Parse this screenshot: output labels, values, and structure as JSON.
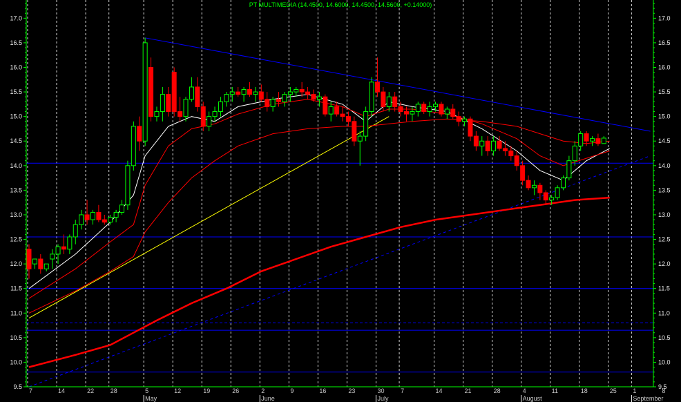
{
  "chart_data": {
    "type": "candlestick",
    "title": "PT MULTIMEDIA (14.4500, 14.6000, 14.4500, 14.5600, +0.14000)",
    "ylim": [
      9.5,
      17.3
    ],
    "y_ticks": [
      "9.5",
      "10.0",
      "10.5",
      "11.0",
      "11.5",
      "12.0",
      "12.5",
      "13.0",
      "13.5",
      "14.0",
      "14.5",
      "15.0",
      "15.5",
      "16.0",
      "16.5",
      "17.0"
    ],
    "x_date_labels": [
      "7",
      "14",
      "22",
      "28",
      "5",
      "12",
      "19",
      "26",
      "2",
      "9",
      "16",
      "23",
      "30",
      "7",
      "14",
      "21",
      "28",
      "4",
      "11",
      "18",
      "25",
      "1",
      "8"
    ],
    "x_month_labels": [
      {
        "label": "May",
        "at": "5"
      },
      {
        "label": "June",
        "at": "2"
      },
      {
        "label": "July",
        "at": "30"
      },
      {
        "label": "August",
        "at": "4"
      },
      {
        "label": "September",
        "at": "1"
      }
    ],
    "colors": {
      "background": "#000000",
      "up": "#00ff00",
      "down": "#ff0000",
      "grid": "#ffffff",
      "axis": "#00ff00",
      "horizontal_levels": "#0000ff",
      "ema_fast": "#ffffff",
      "ema_mid": "#ff0000",
      "ema_long": "#ff0000",
      "trend_support": "#ffff00",
      "trend_resistance": "#0000ff"
    },
    "horizontal_levels": [
      14.05,
      12.55,
      11.5,
      10.8,
      10.65,
      9.8
    ],
    "series": [
      {
        "type": "ohlc",
        "values": [
          [
            12.3,
            12.4,
            11.7,
            11.9
          ],
          [
            12.0,
            12.1,
            11.9,
            12.1
          ],
          [
            12.1,
            12.2,
            11.8,
            11.9
          ],
          [
            11.9,
            12.0,
            11.85,
            12.0
          ],
          [
            12.1,
            12.3,
            11.9,
            12.2
          ],
          [
            12.2,
            12.4,
            12.0,
            12.35
          ],
          [
            12.35,
            12.6,
            12.2,
            12.3
          ],
          [
            12.3,
            12.6,
            12.2,
            12.55
          ],
          [
            12.55,
            12.9,
            12.4,
            12.8
          ],
          [
            12.8,
            13.1,
            12.7,
            13.0
          ],
          [
            13.0,
            13.3,
            12.8,
            12.9
          ],
          [
            12.9,
            13.1,
            12.8,
            13.05
          ],
          [
            13.05,
            13.2,
            12.85,
            12.9
          ],
          [
            12.9,
            13.0,
            12.8,
            12.85
          ],
          [
            12.85,
            13.0,
            12.8,
            12.95
          ],
          [
            12.95,
            13.1,
            12.85,
            13.05
          ],
          [
            13.05,
            13.3,
            13.0,
            13.2
          ],
          [
            13.2,
            14.1,
            13.1,
            14.0
          ],
          [
            14.0,
            14.9,
            13.9,
            14.8
          ],
          [
            14.8,
            15.0,
            14.3,
            14.5
          ],
          [
            14.5,
            16.6,
            14.4,
            16.5
          ],
          [
            16.0,
            16.2,
            14.9,
            15.0
          ],
          [
            15.0,
            15.2,
            14.9,
            15.1
          ],
          [
            15.1,
            15.6,
            14.9,
            15.45
          ],
          [
            15.45,
            15.6,
            15.0,
            15.1
          ],
          [
            15.9,
            16.0,
            15.0,
            15.1
          ],
          [
            15.1,
            15.4,
            14.9,
            15.0
          ],
          [
            15.0,
            15.4,
            14.9,
            15.35
          ],
          [
            15.35,
            15.8,
            15.3,
            15.6
          ],
          [
            15.6,
            15.8,
            15.1,
            15.2
          ],
          [
            15.2,
            15.3,
            14.7,
            14.8
          ],
          [
            14.8,
            15.1,
            14.7,
            15.0
          ],
          [
            15.0,
            15.2,
            14.9,
            15.1
          ],
          [
            15.1,
            15.4,
            15.0,
            15.3
          ],
          [
            15.3,
            15.5,
            15.2,
            15.45
          ],
          [
            15.45,
            15.6,
            15.3,
            15.5
          ],
          [
            15.5,
            15.6,
            15.4,
            15.45
          ],
          [
            15.45,
            15.6,
            15.3,
            15.55
          ],
          [
            15.55,
            15.7,
            15.4,
            15.45
          ],
          [
            15.45,
            15.6,
            15.3,
            15.5
          ],
          [
            15.5,
            15.65,
            15.3,
            15.35
          ],
          [
            15.35,
            15.5,
            15.1,
            15.2
          ],
          [
            15.2,
            15.4,
            15.1,
            15.35
          ],
          [
            15.35,
            15.5,
            15.2,
            15.3
          ],
          [
            15.3,
            15.5,
            15.2,
            15.45
          ],
          [
            15.45,
            15.6,
            15.3,
            15.5
          ],
          [
            15.5,
            15.6,
            15.4,
            15.55
          ],
          [
            15.55,
            15.7,
            15.4,
            15.5
          ],
          [
            15.5,
            15.6,
            15.35,
            15.45
          ],
          [
            15.45,
            15.55,
            15.3,
            15.35
          ],
          [
            15.35,
            15.5,
            15.2,
            15.4
          ],
          [
            15.4,
            15.45,
            15.0,
            15.05
          ],
          [
            15.05,
            15.3,
            14.9,
            15.2
          ],
          [
            15.2,
            15.3,
            15.0,
            15.05
          ],
          [
            15.05,
            15.2,
            14.9,
            15.0
          ],
          [
            15.0,
            15.1,
            14.8,
            14.9
          ],
          [
            14.9,
            15.0,
            14.4,
            14.5
          ],
          [
            14.5,
            14.7,
            14.0,
            14.6
          ],
          [
            14.6,
            15.2,
            14.5,
            15.1
          ],
          [
            15.1,
            15.8,
            15.0,
            15.7
          ],
          [
            15.7,
            16.2,
            15.4,
            15.5
          ],
          [
            15.5,
            15.6,
            15.1,
            15.2
          ],
          [
            15.2,
            15.5,
            15.1,
            15.4
          ],
          [
            15.4,
            15.5,
            15.1,
            15.2
          ],
          [
            15.2,
            15.3,
            15.0,
            15.1
          ],
          [
            15.1,
            15.2,
            14.9,
            15.05
          ],
          [
            15.05,
            15.2,
            14.9,
            15.1
          ],
          [
            15.1,
            15.3,
            15.0,
            15.25
          ],
          [
            15.25,
            15.3,
            15.05,
            15.1
          ],
          [
            15.1,
            15.3,
            15.0,
            15.2
          ],
          [
            15.2,
            15.3,
            15.1,
            15.25
          ],
          [
            15.25,
            15.3,
            15.0,
            15.05
          ],
          [
            15.05,
            15.2,
            14.95,
            15.15
          ],
          [
            15.15,
            15.25,
            14.95,
            15.0
          ],
          [
            15.0,
            15.1,
            14.8,
            14.9
          ],
          [
            14.9,
            15.0,
            14.8,
            14.95
          ],
          [
            14.95,
            15.0,
            14.5,
            14.6
          ],
          [
            14.6,
            14.7,
            14.3,
            14.4
          ],
          [
            14.4,
            14.6,
            14.2,
            14.5
          ],
          [
            14.5,
            14.6,
            14.2,
            14.3
          ],
          [
            14.3,
            14.6,
            14.2,
            14.5
          ],
          [
            14.5,
            14.6,
            14.3,
            14.35
          ],
          [
            14.35,
            14.5,
            14.2,
            14.3
          ],
          [
            14.3,
            14.4,
            14.1,
            14.2
          ],
          [
            14.2,
            14.3,
            13.9,
            14.0
          ],
          [
            14.0,
            14.1,
            13.6,
            13.7
          ],
          [
            13.7,
            13.8,
            13.5,
            13.55
          ],
          [
            13.55,
            13.7,
            13.4,
            13.6
          ],
          [
            13.6,
            13.65,
            13.3,
            13.45
          ],
          [
            13.45,
            13.5,
            13.2,
            13.3
          ],
          [
            13.3,
            13.4,
            13.2,
            13.35
          ],
          [
            13.35,
            13.6,
            13.3,
            13.55
          ],
          [
            13.55,
            13.8,
            13.5,
            13.75
          ],
          [
            13.75,
            14.2,
            13.7,
            14.1
          ],
          [
            14.1,
            14.5,
            14.0,
            14.4
          ],
          [
            14.4,
            14.7,
            14.3,
            14.65
          ],
          [
            14.65,
            14.7,
            14.4,
            14.5
          ],
          [
            14.5,
            14.6,
            14.4,
            14.55
          ],
          [
            14.55,
            14.65,
            14.4,
            14.45
          ],
          [
            14.45,
            14.6,
            14.45,
            14.56
          ]
        ]
      },
      {
        "type": "line",
        "role": "ema_fast",
        "values": [
          [
            0,
            11.5
          ],
          [
            8,
            12.2
          ],
          [
            14,
            12.85
          ],
          [
            18,
            13.4
          ],
          [
            20,
            14.2
          ],
          [
            24,
            14.8
          ],
          [
            28,
            15.0
          ],
          [
            32,
            14.9
          ],
          [
            36,
            15.2
          ],
          [
            42,
            15.35
          ],
          [
            48,
            15.45
          ],
          [
            54,
            15.25
          ],
          [
            58,
            14.9
          ],
          [
            62,
            15.3
          ],
          [
            66,
            15.2
          ],
          [
            72,
            15.1
          ],
          [
            78,
            14.75
          ],
          [
            84,
            14.3
          ],
          [
            88,
            13.9
          ],
          [
            92,
            13.7
          ],
          [
            96,
            14.1
          ],
          [
            100,
            14.35
          ]
        ]
      },
      {
        "type": "line",
        "role": "ema_mid",
        "values": [
          [
            0,
            11.3
          ],
          [
            8,
            11.9
          ],
          [
            14,
            12.45
          ],
          [
            18,
            12.8
          ],
          [
            20,
            13.6
          ],
          [
            24,
            14.4
          ],
          [
            28,
            14.75
          ],
          [
            32,
            14.85
          ],
          [
            36,
            15.05
          ],
          [
            42,
            15.25
          ],
          [
            48,
            15.35
          ],
          [
            54,
            15.2
          ],
          [
            58,
            15.0
          ],
          [
            62,
            15.15
          ],
          [
            66,
            15.15
          ],
          [
            72,
            15.05
          ],
          [
            78,
            14.85
          ],
          [
            84,
            14.55
          ],
          [
            88,
            14.2
          ],
          [
            92,
            14.0
          ],
          [
            96,
            14.15
          ],
          [
            100,
            14.3
          ]
        ]
      },
      {
        "type": "line",
        "role": "ema_slow",
        "values": [
          [
            0,
            11.0
          ],
          [
            8,
            11.45
          ],
          [
            14,
            11.85
          ],
          [
            18,
            12.15
          ],
          [
            20,
            12.65
          ],
          [
            24,
            13.25
          ],
          [
            28,
            13.75
          ],
          [
            32,
            14.1
          ],
          [
            36,
            14.4
          ],
          [
            42,
            14.65
          ],
          [
            48,
            14.75
          ],
          [
            54,
            14.8
          ],
          [
            58,
            14.8
          ],
          [
            62,
            14.85
          ],
          [
            66,
            14.9
          ],
          [
            72,
            14.95
          ],
          [
            78,
            14.9
          ],
          [
            84,
            14.8
          ],
          [
            88,
            14.65
          ],
          [
            92,
            14.5
          ],
          [
            96,
            14.45
          ],
          [
            100,
            14.5
          ]
        ]
      },
      {
        "type": "line",
        "role": "ema_long",
        "values": [
          [
            0,
            9.9
          ],
          [
            8,
            10.15
          ],
          [
            14,
            10.35
          ],
          [
            18,
            10.6
          ],
          [
            22,
            10.85
          ],
          [
            28,
            11.2
          ],
          [
            34,
            11.5
          ],
          [
            40,
            11.85
          ],
          [
            46,
            12.1
          ],
          [
            52,
            12.35
          ],
          [
            58,
            12.55
          ],
          [
            64,
            12.75
          ],
          [
            70,
            12.9
          ],
          [
            76,
            13.0
          ],
          [
            82,
            13.1
          ],
          [
            88,
            13.2
          ],
          [
            94,
            13.3
          ],
          [
            100,
            13.35
          ]
        ]
      }
    ],
    "trendlines": [
      {
        "role": "support",
        "from": [
          0,
          10.9
        ],
        "to": [
          62,
          15.0
        ]
      },
      {
        "role": "resistance",
        "from": [
          20,
          16.6
        ],
        "to": [
          107,
          14.7
        ]
      },
      {
        "role": "support_dashed",
        "from": [
          0,
          9.5
        ],
        "to": [
          107,
          14.2
        ]
      }
    ]
  }
}
